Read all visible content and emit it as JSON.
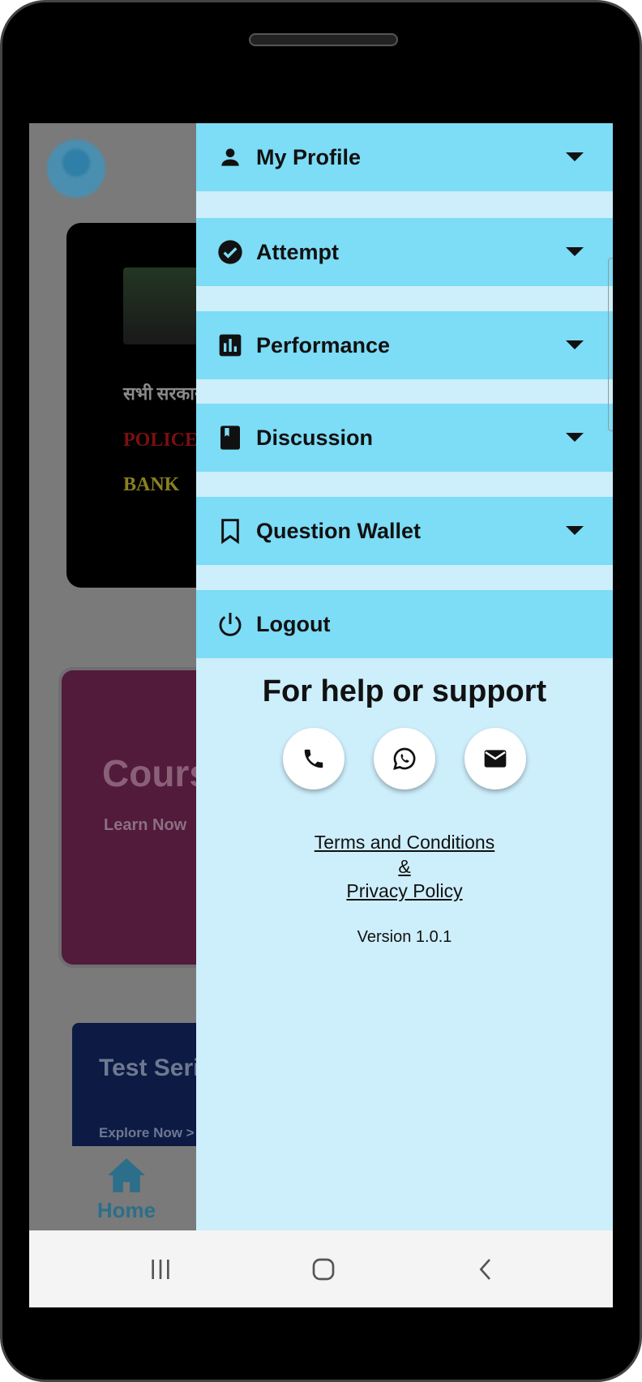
{
  "background": {
    "banner_hindi": "सभी सरकारी नौ",
    "banner_police": "POLICE",
    "banner_bank": "BANK",
    "course_title": "Cours",
    "course_subtitle": "Learn Now",
    "test_title": "Test Series",
    "test_subtitle": "Explore Now >",
    "bottom_nav_home": "Home"
  },
  "drawer": {
    "items": [
      {
        "label": "My Profile",
        "icon": "person-icon",
        "expandable": true
      },
      {
        "label": "Attempt",
        "icon": "check-circle-icon",
        "expandable": true
      },
      {
        "label": "Performance",
        "icon": "bar-chart-icon",
        "expandable": true
      },
      {
        "label": "Discussion",
        "icon": "book-icon",
        "expandable": true
      },
      {
        "label": "Question Wallet",
        "icon": "bookmark-icon",
        "expandable": true
      },
      {
        "label": "Logout",
        "icon": "power-icon",
        "expandable": false
      }
    ],
    "help_title": "For help or support",
    "contact_buttons": [
      "phone-icon",
      "whatsapp-icon",
      "email-icon"
    ],
    "terms_link": "Terms and Conditions",
    "ampersand": "&",
    "privacy_link": "Privacy Policy",
    "version": "Version 1.0.1"
  },
  "colors": {
    "menu_item": "#7ddcf6",
    "drawer_bg": "#cdeefb"
  }
}
